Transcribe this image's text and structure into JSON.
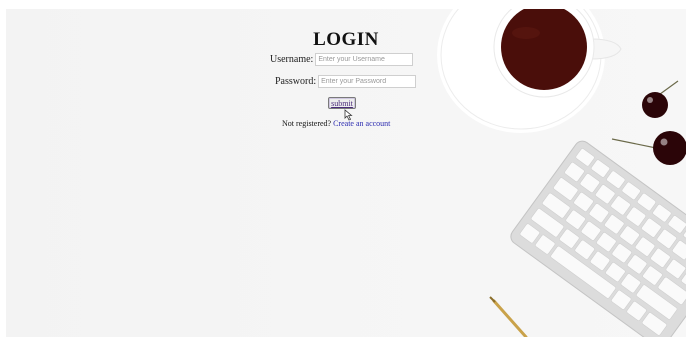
{
  "login": {
    "title": "LOGIN",
    "username_label": "Username:",
    "username_placeholder": "Enter your Username",
    "password_label": "Password:",
    "password_placeholder": "Enter your Password",
    "submit_label": "submit",
    "not_registered_text": "Not registered?",
    "create_account_link": "Create an account"
  },
  "colors": {
    "link": "#2b2bb0",
    "submit_text": "#4a2a7a",
    "background": "#f4f4f4"
  }
}
